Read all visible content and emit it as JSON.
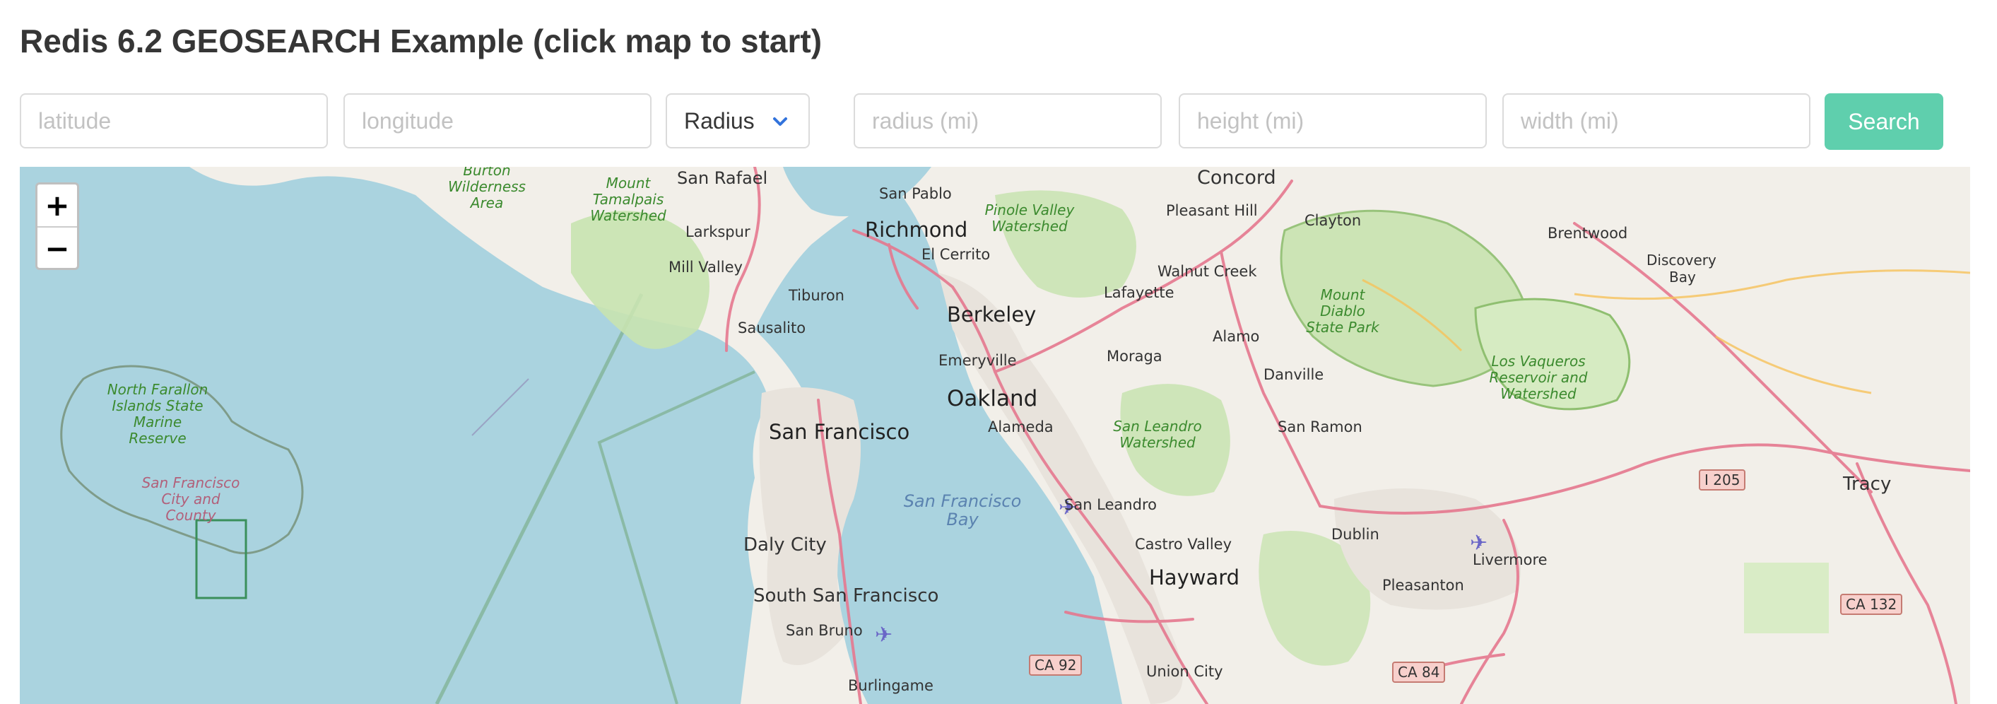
{
  "page": {
    "title": "Redis 6.2 GEOSEARCH Example (click map to start)"
  },
  "form": {
    "latitude_placeholder": "latitude",
    "latitude_value": "",
    "longitude_placeholder": "longitude",
    "longitude_value": "",
    "shape_selected": "Radius",
    "radius_placeholder": "radius (mi)",
    "height_placeholder": "height (mi)",
    "width_placeholder": "width (mi)",
    "search_label": "Search"
  },
  "map": {
    "zoom_in": "+",
    "zoom_out": "−",
    "colors": {
      "water": "#aad3df",
      "land": "#f2efe9",
      "park": "#c8e3b0",
      "road": "#e5788f",
      "accent": "#5fcfad"
    },
    "cities": {
      "san_rafael": "San Rafael",
      "san_pablo": "San Pablo",
      "concord": "Concord",
      "richmond": "Richmond",
      "larkspur": "Larkspur",
      "pleasant_hill": "Pleasant Hill",
      "clayton": "Clayton",
      "brentwood": "Brentwood",
      "el_cerrito": "El Cerrito",
      "mill_valley": "Mill Valley",
      "walnut_creek": "Walnut Creek",
      "discovery": "Discovery",
      "bay": "Bay",
      "tiburon": "Tiburon",
      "lafayette": "Lafayette",
      "berkeley": "Berkeley",
      "sausalito": "Sausalito",
      "alamo": "Alamo",
      "moraga": "Moraga",
      "emeryville": "Emeryville",
      "danville": "Danville",
      "oakland": "Oakland",
      "san_francisco": "San Francisco",
      "alameda": "Alameda",
      "san_ramon": "San Ramon",
      "tracy": "Tracy",
      "san_leandro": "San Leandro",
      "daly_city": "Daly City",
      "dublin": "Dublin",
      "castro_valley": "Castro Valley",
      "livermore": "Livermore",
      "hayward": "Hayward",
      "pleasanton": "Pleasanton",
      "south_san_francisco": "South San Francisco",
      "san_bruno": "San Bruno",
      "union_city": "Union City",
      "burlingame": "Burlingame"
    },
    "parks": {
      "burton": "Burton Wilderness Area",
      "tamalpais": "Mount Tamalpais Watershed",
      "pinole": "Pinole Valley Watershed",
      "diablo": "Mount Diablo State Park",
      "vaqueros": "Los Vaqueros Reservoir and Watershed",
      "leandro": "San Leandro Watershed",
      "farallon": "North Farallon Islands State Marine Reserve"
    },
    "sf_county": "San Francisco City and County",
    "bay_label": "San Francisco Bay",
    "shields": {
      "i205": "I 205",
      "ca132": "CA 132",
      "ca92": "CA 92",
      "ca84": "CA 84"
    }
  }
}
